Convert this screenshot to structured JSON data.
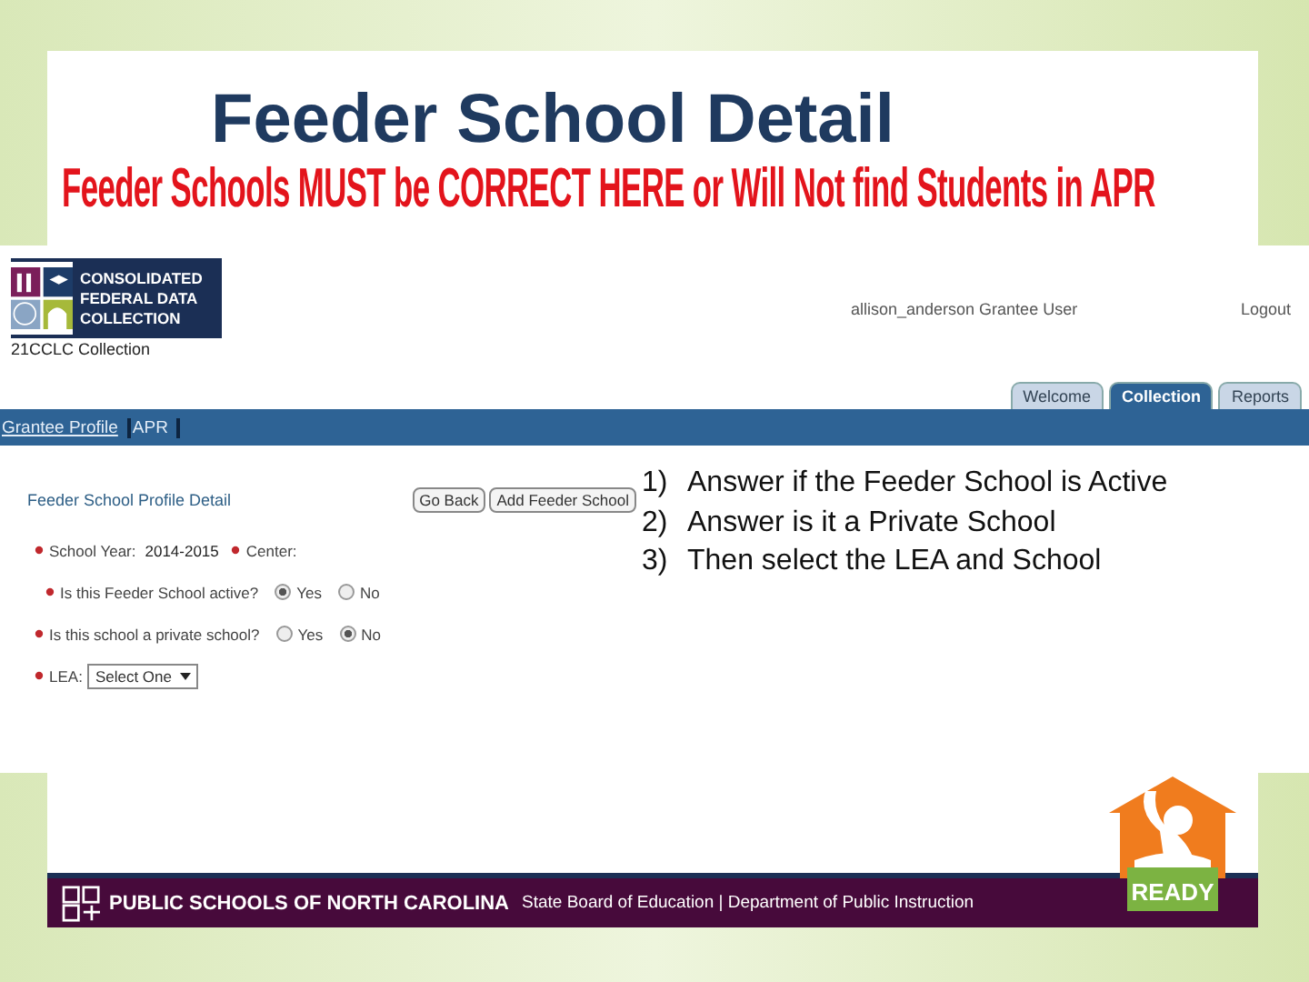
{
  "slide": {
    "title": "Feeder School Detail",
    "warning": "Feeder Schools MUST be CORRECT HERE or Will Not find Students in APR"
  },
  "app": {
    "logo_lines": [
      "CONSOLIDATED",
      "FEDERAL DATA",
      "COLLECTION"
    ],
    "collection_label": "21CCLC Collection",
    "user": "allison_anderson Grantee User",
    "logout": "Logout",
    "tabs": [
      {
        "label": "Welcome",
        "selected": false
      },
      {
        "label": "Collection",
        "selected": true
      },
      {
        "label": "Reports",
        "selected": false
      }
    ],
    "nav_links": [
      {
        "label": "Grantee Profile",
        "underlined": true
      },
      {
        "label": "APR",
        "underlined": false
      }
    ],
    "form": {
      "heading": "Feeder School Profile Detail",
      "buttons": [
        "Go Back",
        "Add Feeder School"
      ],
      "school_year_label": "School Year:",
      "school_year": "2014-2015",
      "center_label": "Center:",
      "questions": [
        {
          "label": "Is this Feeder School active?",
          "options": [
            {
              "label": "Yes",
              "selected": true
            },
            {
              "label": "No",
              "selected": false
            }
          ]
        },
        {
          "label": "Is this school a private school?",
          "options": [
            {
              "label": "Yes",
              "selected": false
            },
            {
              "label": "No",
              "selected": true
            }
          ]
        }
      ],
      "lea_label": "LEA:",
      "lea_select": "Select One"
    },
    "instructions": [
      {
        "number": "1)",
        "text": "Answer if the Feeder School is Active"
      },
      {
        "number": "2)",
        "text": "Answer is it a Private School"
      },
      {
        "number": "3)",
        "text": "Then select the LEA and School"
      }
    ]
  },
  "footer": {
    "org": "PUBLIC SCHOOLS OF NORTH CAROLINA",
    "subtitle": "State Board of Education | Department of Public Instruction",
    "badge": "READY"
  }
}
